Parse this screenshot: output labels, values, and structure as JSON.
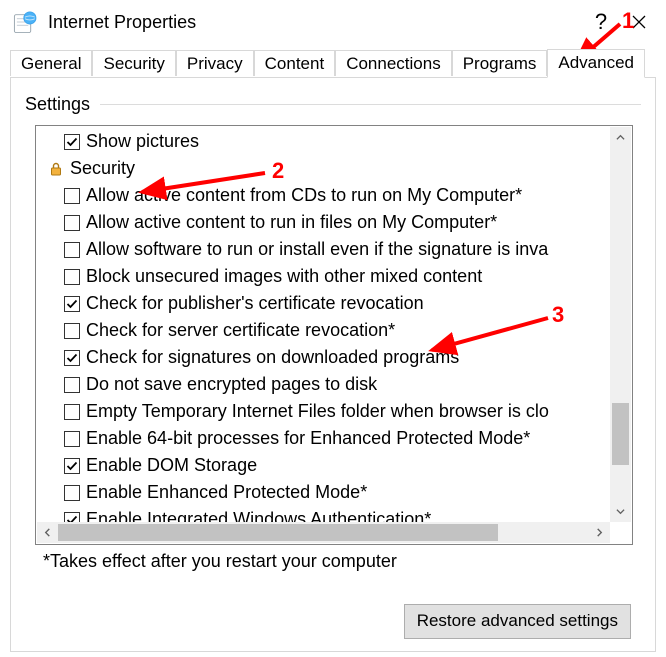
{
  "window": {
    "title": "Internet Properties",
    "help_glyph": "?",
    "close_glyph": "×"
  },
  "tabs": [
    "General",
    "Security",
    "Privacy",
    "Content",
    "Connections",
    "Programs",
    "Advanced"
  ],
  "active_tab_index": 6,
  "group_label": "Settings",
  "rows": [
    {
      "kind": "item",
      "checked": true,
      "label": "Show pictures"
    },
    {
      "kind": "category",
      "icon": "lock",
      "label": "Security"
    },
    {
      "kind": "item",
      "checked": false,
      "label": "Allow active content from CDs to run on My Computer*"
    },
    {
      "kind": "item",
      "checked": false,
      "label": "Allow active content to run in files on My Computer*"
    },
    {
      "kind": "item",
      "checked": false,
      "label": "Allow software to run or install even if the signature is inva"
    },
    {
      "kind": "item",
      "checked": false,
      "label": "Block unsecured images with other mixed content"
    },
    {
      "kind": "item",
      "checked": true,
      "label": "Check for publisher's certificate revocation"
    },
    {
      "kind": "item",
      "checked": false,
      "label": "Check for server certificate revocation*"
    },
    {
      "kind": "item",
      "checked": true,
      "label": "Check for signatures on downloaded programs"
    },
    {
      "kind": "item",
      "checked": false,
      "label": "Do not save encrypted pages to disk"
    },
    {
      "kind": "item",
      "checked": false,
      "label": "Empty Temporary Internet Files folder when browser is clo"
    },
    {
      "kind": "item",
      "checked": false,
      "label": "Enable 64-bit processes for Enhanced Protected Mode*"
    },
    {
      "kind": "item",
      "checked": true,
      "label": "Enable DOM Storage"
    },
    {
      "kind": "item",
      "checked": false,
      "label": "Enable Enhanced Protected Mode*"
    },
    {
      "kind": "item",
      "checked": true,
      "label": "Enable Integrated Windows Authentication*"
    }
  ],
  "note": "*Takes effect after you restart your computer",
  "restore_button": "Restore advanced settings",
  "annotations": {
    "a1": "1",
    "a2": "2",
    "a3": "3"
  }
}
